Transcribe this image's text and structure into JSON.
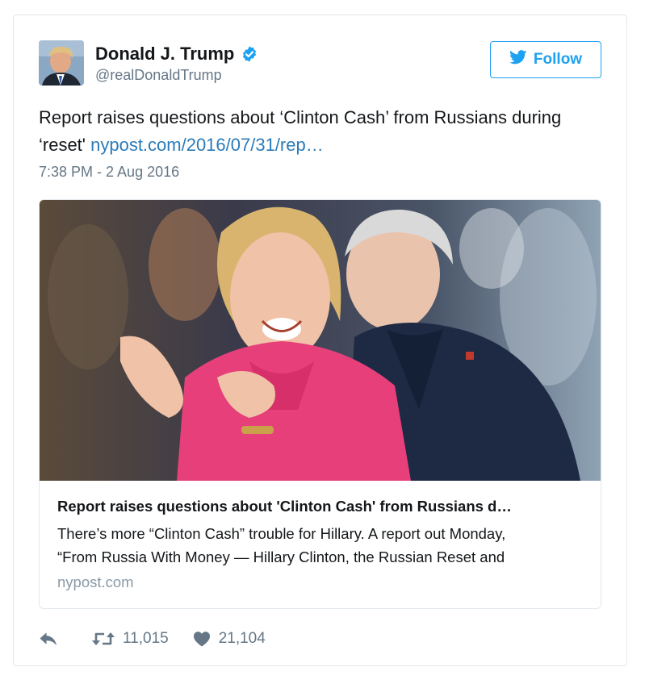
{
  "user": {
    "display_name": "Donald J. Trump",
    "handle": "@realDonaldTrump",
    "verified_icon": "verified-badge-icon"
  },
  "follow_button": {
    "label": "Follow",
    "icon": "twitter-bird-icon"
  },
  "tweet": {
    "text": "Report raises questions about ‘Clinton Cash’ from Russians during ‘reset' ",
    "link_text": "nypost.com/2016/07/31/rep…",
    "timestamp": "7:38 PM - 2 Aug 2016"
  },
  "card": {
    "title": "Report raises questions about 'Clinton Cash' from Russians d…",
    "description_line1": "There’s more “Clinton Cash” trouble for Hillary. A report out Monday,",
    "description_line2": "“From Russia With Money — Hillary Clinton, the Russian Reset and",
    "domain": "nypost.com"
  },
  "actions": {
    "reply_icon": "reply-icon",
    "retweet_icon": "retweet-icon",
    "retweets": "11,015",
    "like_icon": "heart-icon",
    "likes": "21,104"
  },
  "colors": {
    "accent": "#1da1f2",
    "link": "#2b7bb9",
    "secondary_text": "#657786",
    "border": "#e1e8ed"
  }
}
